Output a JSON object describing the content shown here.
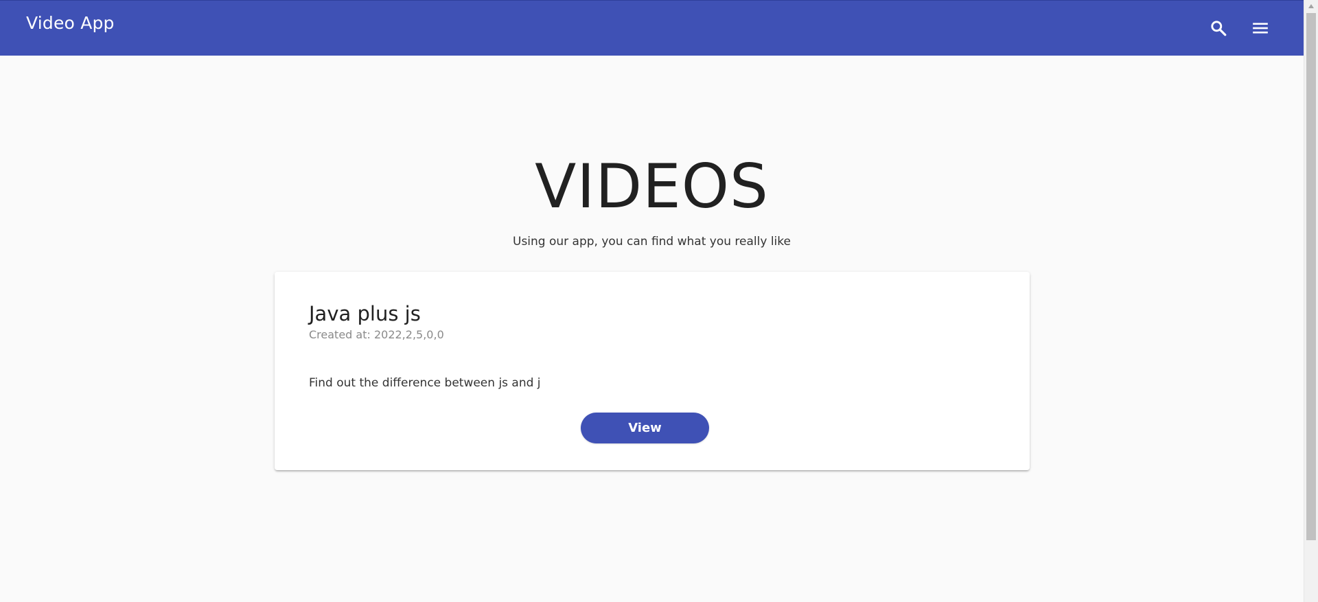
{
  "appbar": {
    "title": "Video App",
    "color": "#3f51b5",
    "icons": [
      "search-icon",
      "menu-icon"
    ]
  },
  "hero": {
    "title": "VIDEOS",
    "subtitle": "Using our app, you can find what you really like"
  },
  "videos": [
    {
      "title": "Java plus js",
      "created_at": "Created at: 2022,2,5,0,0",
      "description": "Find out the difference between js and j",
      "button_label": "View"
    }
  ]
}
